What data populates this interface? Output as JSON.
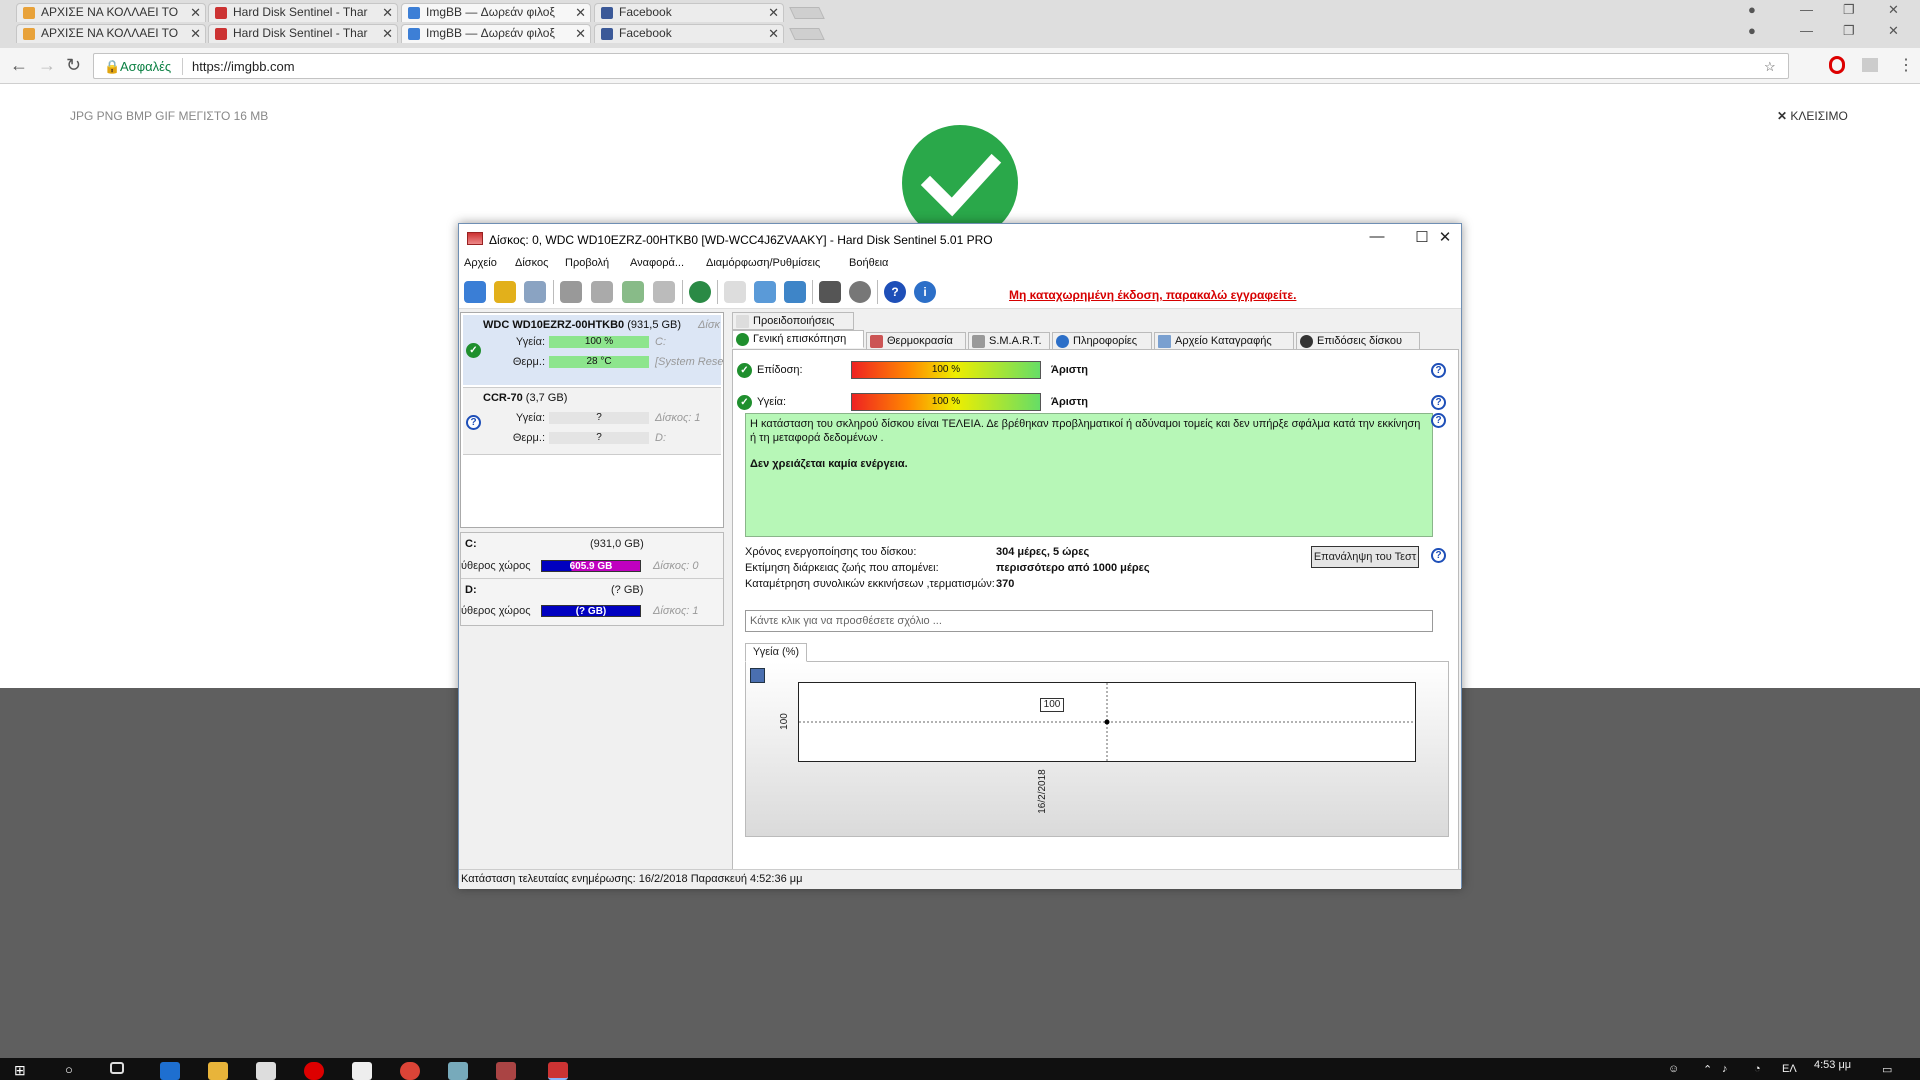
{
  "browser": {
    "tabs_back": [
      {
        "title": "ΑΡΧΙΣΕ ΝΑ ΚΟΛΛΑΕΙ ΤΟ"
      },
      {
        "title": "Hard Disk Sentinel - Thar"
      },
      {
        "title": "ImgBB — Δωρεάν φιλοξ"
      },
      {
        "title": "Facebook"
      }
    ],
    "tabs_front": [
      {
        "title": "ΑΡΧΙΣΕ ΝΑ ΚΟΛΛΑΕΙ ΤΟ"
      },
      {
        "title": "Hard Disk Sentinel - Thar"
      },
      {
        "title": "ImgBB — Δωρεάν φιλοξ"
      },
      {
        "title": "Facebook"
      }
    ],
    "secure_label": "Ασφαλές",
    "url": "https://imgbb.com"
  },
  "imgbb": {
    "file_types": "JPG PNG BMP GIF   ΜΕΓΙΣΤΟ 16 MB",
    "close_label": "ΚΛΕΙΣΙΜΟ"
  },
  "hds": {
    "title": "Δίσκος: 0, WDC WD10EZRZ-00HTKB0 [WD-WCC4J6ZVAAKY]  -  Hard Disk Sentinel 5.01 PRO",
    "menu": [
      "Αρχείο",
      "Δίσκος",
      "Προβολή",
      "Αναφορά...",
      "Διαμόρφωση/Ρυθμίσεις",
      "Βοήθεια"
    ],
    "register_text": "Μη καταχωρημένη έκδοση, παρακαλώ εγγραφείτε.",
    "disks": [
      {
        "name": "WDC WD10EZRZ-00HTKB0",
        "capacity": "(931,5 GB)",
        "side_label": "Δίσκ",
        "health_label": "Υγεία:",
        "health": "100 %",
        "health_side": "C:",
        "temp_label": "Θερμ.:",
        "temp": "28 °C",
        "temp_side": "[System Rese"
      },
      {
        "name": "CCR-70",
        "capacity": "(3,7 GB)",
        "health_label": "Υγεία:",
        "health": "?",
        "health_side": "Δίσκος: 1",
        "temp_label": "Θερμ.:",
        "temp": "?",
        "temp_side": "D:"
      }
    ],
    "volumes": [
      {
        "letter": "C:",
        "size": "(931,0 GB)",
        "free_label": "ύθερος χώρος",
        "free": "605.9 GB",
        "disk": "Δίσκος: 0",
        "color": "#c000c0"
      },
      {
        "letter": "D:",
        "size": "(? GB)",
        "free_label": "ύθερος χώρος",
        "free": "(? GB)",
        "disk": "Δίσκος: 1",
        "color": "#0000c0"
      }
    ],
    "tabs_top": [
      "Προειδοποιήσεις"
    ],
    "tabs": [
      "Γενική επισκόπηση",
      "Θερμοκρασία",
      "S.M.A.R.T.",
      "Πληροφορίες",
      "Αρχείο Καταγραφής",
      "Επιδόσεις δίσκου"
    ],
    "performance_label": "Επίδοση:",
    "performance_value": "100 %",
    "performance_grade": "Άριστη",
    "health_label": "Υγεία:",
    "health_value": "100 %",
    "health_grade": "Άριστη",
    "status_text": "Η κατάσταση του σκληρού δίσκου είναι ΤΕΛΕΙΑ. Δε βρέθηκαν προβληματικοί ή αδύναμοι τομείς και δεν υπήρξε σφάλμα κατά την εκκίνηση ή τη μεταφορά δεδομένων .",
    "status_action": "Δεν χρειάζεται καμία ενέργεια.",
    "info": [
      {
        "label": "Χρόνος ενεργοποίησης του δίσκου:",
        "value": "304 μέρες, 5 ώρες"
      },
      {
        "label": "Εκτίμηση διάρκειας ζωής που απομένει:",
        "value": "περισσότερο από 1000 μέρες"
      },
      {
        "label": "Καταμέτρηση συνολικών εκκινήσεων ,τερματισμών:",
        "value": "370"
      }
    ],
    "retest_label": "Επανάληψη του Τεστ",
    "comment_placeholder": "Κάντε κλικ για να προσθέσετε σχόλιο ...",
    "chart_tab": "Υγεία (%)",
    "statusbar": "Κατάσταση τελευταίας ενημέρωσης: 16/2/2018 Παρασκευή 4:52:36 μμ"
  },
  "chart_data": {
    "type": "line",
    "title": "Υγεία (%)",
    "x": [
      "16/2/2018"
    ],
    "series": [
      {
        "values": [
          100
        ]
      }
    ],
    "ytick": "100",
    "data_label": "100"
  },
  "taskbar": {
    "lang": "ΕΛ",
    "time": "4:53 μμ"
  }
}
